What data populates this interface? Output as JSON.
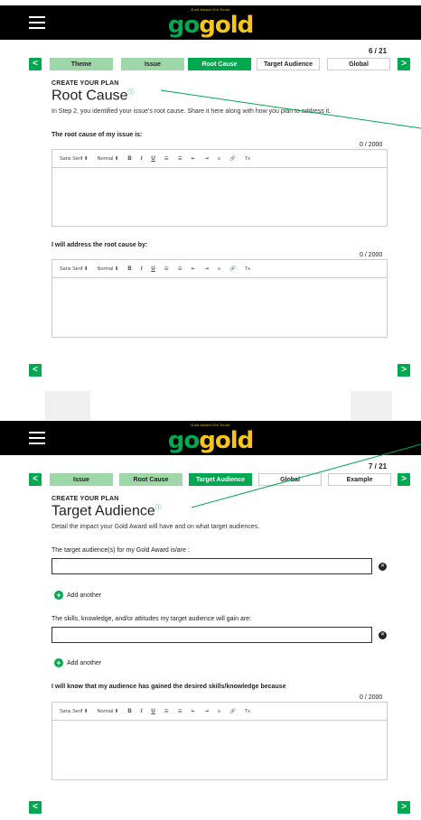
{
  "app": {
    "logo_tagline": "Gold Award Girl Scout",
    "logo_go": "go",
    "logo_gold": "gold"
  },
  "screen1": {
    "counter": "6 / 21",
    "nav": {
      "prev": "<",
      "next": ">"
    },
    "steps": [
      "Theme",
      "Issue",
      "Root Cause",
      "Target Audience",
      "Global"
    ],
    "kicker": "CREATE YOUR PLAN",
    "title": "Root Cause",
    "description": "In Step 2, you identified your issue's root cause. Share it here along with how you plan to address it.",
    "field1": {
      "label": "The root cause of my issue is:",
      "count": "0 / 2000"
    },
    "field2": {
      "label": "I will address the root cause by:",
      "count": "0 / 2000"
    },
    "toolbar": {
      "font": "Sans Serif",
      "size": "Normal",
      "bold": "B",
      "italic": "I",
      "underline": "U"
    },
    "bottom_prev": "<",
    "bottom_next": ">"
  },
  "screen2": {
    "counter": "7 / 21",
    "nav": {
      "prev": "<",
      "next": ">"
    },
    "steps": [
      "Issue",
      "Root Cause",
      "Target Audience",
      "Global",
      "Example"
    ],
    "kicker": "CREATE YOUR PLAN",
    "title": "Target Audience",
    "description": "Detail the impact your Gold Award will have and on what target audiences.",
    "field1": {
      "label": "The target audience(s) for my Gold Award is/are :",
      "value": ""
    },
    "field2": {
      "label": "The skills, knowledge, and/or attitudes my target audience will gain are:",
      "value": ""
    },
    "add_another": "Add another",
    "field3": {
      "label": "I will know that my audience has gained the desired skills/knowledge because",
      "count": "0 / 2000"
    },
    "toolbar": {
      "font": "Sans Serif",
      "size": "Normal",
      "bold": "B",
      "italic": "I",
      "underline": "U"
    },
    "bottom_prev": "<",
    "bottom_next": ">"
  },
  "colors": {
    "brand_green": "#00a84f",
    "light_green": "#9fd8a8",
    "gold": "#f5c518",
    "header_bg": "#000000"
  },
  "icons": {
    "menu": "hamburger-icon",
    "info": "info-icon",
    "clear": "close-circle-icon",
    "add": "plus-circle-icon"
  }
}
